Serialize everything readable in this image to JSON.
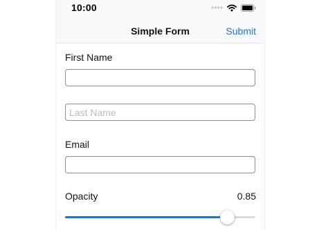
{
  "status_bar": {
    "time": "10:00",
    "icons": [
      "signal-dots-icon",
      "wifi-icon",
      "battery-icon"
    ]
  },
  "nav": {
    "title": "Simple Form",
    "submit_label": "Submit"
  },
  "form": {
    "first_name": {
      "label": "First Name",
      "value": "",
      "placeholder": ""
    },
    "last_name": {
      "label": "",
      "value": "",
      "placeholder": "Last Name"
    },
    "email": {
      "label": "Email",
      "value": "",
      "placeholder": ""
    },
    "opacity": {
      "label": "Opacity",
      "value_text": "0.85",
      "value": 0.85
    }
  },
  "colors": {
    "accent": "#1a73d9",
    "nav_background": "#f8f9fb",
    "field_border": "#8a8f95",
    "placeholder": "#b9bcc0"
  }
}
